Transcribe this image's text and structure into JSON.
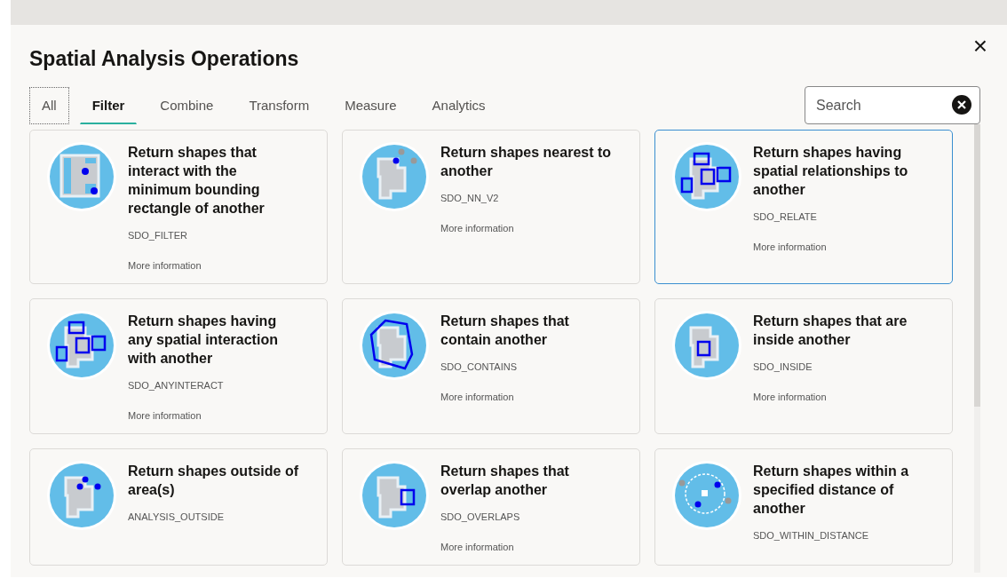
{
  "dialog": {
    "title": "Spatial Analysis Operations",
    "close": "×"
  },
  "tabs": [
    {
      "label": "All",
      "selected": false,
      "focused": true
    },
    {
      "label": "Filter",
      "selected": true,
      "focused": false
    },
    {
      "label": "Combine",
      "selected": false,
      "focused": false
    },
    {
      "label": "Transform",
      "selected": false,
      "focused": false
    },
    {
      "label": "Measure",
      "selected": false,
      "focused": false
    },
    {
      "label": "Analytics",
      "selected": false,
      "focused": false
    }
  ],
  "search": {
    "placeholder": "Search"
  },
  "cards": [
    {
      "kind": "mbr",
      "title": "Return shapes that interact with the minimum bounding rectangle of another",
      "code": "SDO_FILTER",
      "link": "More information",
      "selected": false
    },
    {
      "kind": "nearest",
      "title": "Return shapes nearest to another",
      "code": "SDO_NN_V2",
      "link": "More information",
      "selected": false
    },
    {
      "kind": "relate",
      "title": "Return shapes having spatial relationships to another",
      "code": "SDO_RELATE",
      "link": "More information",
      "selected": true
    },
    {
      "kind": "anyinteract",
      "title": "Return shapes having any spatial interaction with another",
      "code": "SDO_ANYINTERACT",
      "link": "More information",
      "selected": false
    },
    {
      "kind": "contains",
      "title": "Return shapes that contain another",
      "code": "SDO_CONTAINS",
      "link": "More information",
      "selected": false
    },
    {
      "kind": "inside",
      "title": "Return shapes that are inside another",
      "code": "SDO_INSIDE",
      "link": "More information",
      "selected": false
    },
    {
      "kind": "outside",
      "title": "Return shapes outside of area(s)",
      "code": "ANALYSIS_OUTSIDE",
      "selected": false
    },
    {
      "kind": "overlaps",
      "title": "Return shapes that overlap another",
      "code": "SDO_OVERLAPS",
      "link": "More information",
      "selected": false
    },
    {
      "kind": "distance",
      "title": "Return shapes within a specified distance of another",
      "code": "SDO_WITHIN_DISTANCE",
      "selected": false
    }
  ]
}
